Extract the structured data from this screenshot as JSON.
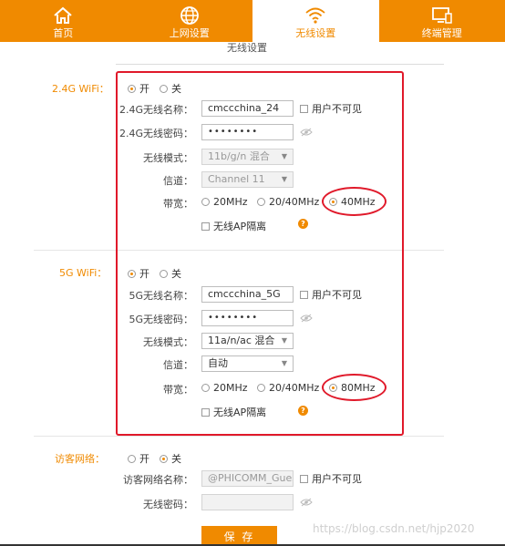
{
  "nav": {
    "tabs": [
      {
        "label": "首页",
        "icon": "home-icon"
      },
      {
        "label": "上网设置",
        "icon": "globe-icon"
      },
      {
        "label": "无线设置",
        "icon": "wifi-icon"
      },
      {
        "label": "终端管理",
        "icon": "devices-icon"
      }
    ],
    "active_index": 2
  },
  "page": {
    "subtitle": "无线设置"
  },
  "colors": {
    "accent": "#f08a00",
    "highlight": "#e0192a"
  },
  "wifi24": {
    "section_label": "2.4G WiFi：",
    "on_label": "开",
    "off_label": "关",
    "enabled": true,
    "ssid_label": "2.4G无线名称：",
    "ssid_value": "cmccchina_24",
    "hidden_label": "用户不可见",
    "password_label": "2.4G无线密码：",
    "password_value": "••••••••",
    "mode_label": "无线模式：",
    "mode_value": "11b/g/n 混合",
    "channel_label": "信道：",
    "channel_value": "Channel 11",
    "bandwidth_label": "带宽：",
    "bw_options": [
      "20MHz",
      "20/40MHz",
      "40MHz"
    ],
    "bw_selected": "40MHz",
    "ap_isolation_label": "无线AP隔离",
    "help_symbol": "?"
  },
  "wifi5": {
    "section_label": "5G WiFi：",
    "on_label": "开",
    "off_label": "关",
    "enabled": true,
    "ssid_label": "5G无线名称：",
    "ssid_value": "cmccchina_5G",
    "hidden_label": "用户不可见",
    "password_label": "5G无线密码：",
    "password_value": "••••••••",
    "mode_label": "无线模式：",
    "mode_value": "11a/n/ac 混合",
    "channel_label": "信道：",
    "channel_value": "自动",
    "bandwidth_label": "带宽：",
    "bw_options": [
      "20MHz",
      "20/40MHz",
      "80MHz"
    ],
    "bw_selected": "80MHz",
    "ap_isolation_label": "无线AP隔离",
    "help_symbol": "?"
  },
  "guest": {
    "section_label": "访客网络：",
    "on_label": "开",
    "off_label": "关",
    "enabled": false,
    "ssid_label": "访客网络名称：",
    "ssid_value": "@PHICOMM_Gues",
    "hidden_label": "用户不可见",
    "password_label": "无线密码：",
    "password_value": ""
  },
  "actions": {
    "save_label": "保 存"
  },
  "watermark": "https://blog.csdn.net/hjp2020"
}
